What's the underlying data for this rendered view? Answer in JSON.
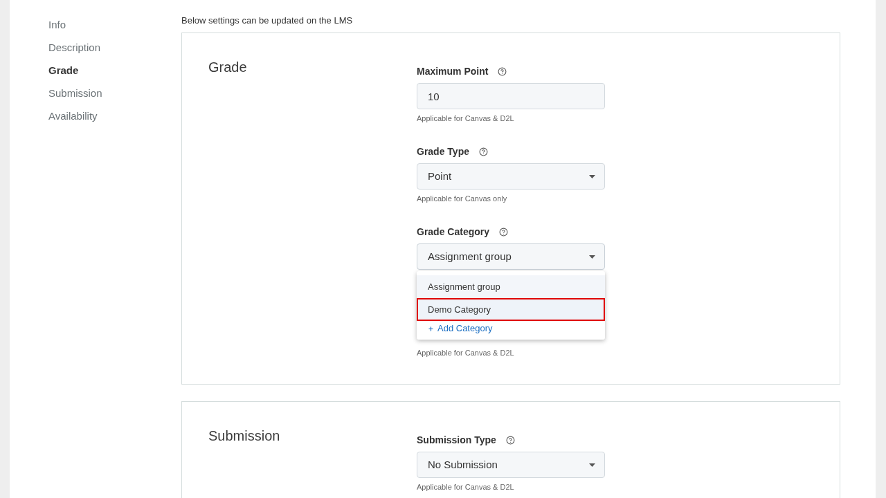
{
  "sidebar": {
    "items": [
      {
        "label": "Info",
        "selected": false
      },
      {
        "label": "Description",
        "selected": false
      },
      {
        "label": "Grade",
        "selected": true
      },
      {
        "label": "Submission",
        "selected": false
      },
      {
        "label": "Availability",
        "selected": false
      }
    ]
  },
  "notice": "Below settings can be updated on the LMS",
  "sections": [
    {
      "title": "Grade",
      "fields": [
        {
          "kind": "input",
          "label": "Maximum Point",
          "value": "10",
          "help_text": "Applicable for Canvas & D2L"
        },
        {
          "kind": "select",
          "label": "Grade Type",
          "value": "Point",
          "expanded": false,
          "help_text": "Applicable for Canvas only"
        },
        {
          "kind": "select",
          "label": "Grade Category",
          "value": "Assignment group",
          "expanded": true,
          "options": [
            {
              "label": "Assignment group",
              "selected": true,
              "highlighted": false
            },
            {
              "label": "Demo Category",
              "selected": false,
              "highlighted": true
            }
          ],
          "action": "Add Category",
          "help_text": "Applicable for Canvas & D2L"
        }
      ]
    },
    {
      "title": "Submission",
      "fields": [
        {
          "kind": "select",
          "label": "Submission Type",
          "value": "No Submission",
          "expanded": false,
          "help_text": "Applicable for Canvas & D2L"
        }
      ]
    }
  ]
}
